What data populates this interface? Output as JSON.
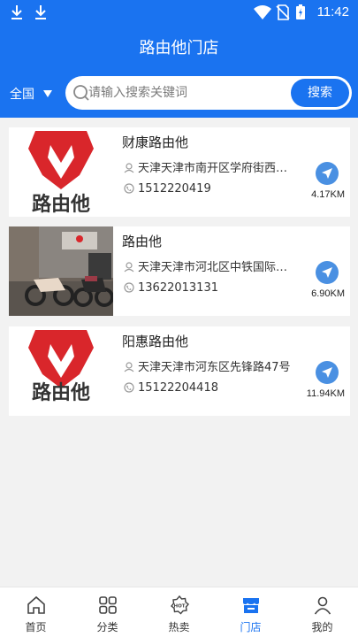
{
  "status": {
    "time": "11:42"
  },
  "header": {
    "title": "路由他门店"
  },
  "region": {
    "label": "全国"
  },
  "search": {
    "placeholder": "请输入搜索关键词",
    "button": "搜索"
  },
  "brand": {
    "logo_text": "路由他",
    "accent": "#1a73f0",
    "logo_red": "#d9262b"
  },
  "stores": [
    {
      "name": "财康路由他",
      "address": "天津天津市南开区学府街西…",
      "phone": "1512220419",
      "distance": "4.17KM"
    },
    {
      "name": "路由他",
      "address": "天津天津市河北区中铁国际…",
      "phone": "13622013131",
      "distance": "6.90KM"
    },
    {
      "name": "阳惠路由他",
      "address": "天津天津市河东区先锋路47号",
      "phone": "15122204418",
      "distance": "11.94KM"
    }
  ],
  "tabs": [
    {
      "label": "首页",
      "icon": "home-icon"
    },
    {
      "label": "分类",
      "icon": "category-icon"
    },
    {
      "label": "热卖",
      "icon": "hot-icon"
    },
    {
      "label": "门店",
      "icon": "store-icon",
      "active": true
    },
    {
      "label": "我的",
      "icon": "user-icon"
    }
  ]
}
